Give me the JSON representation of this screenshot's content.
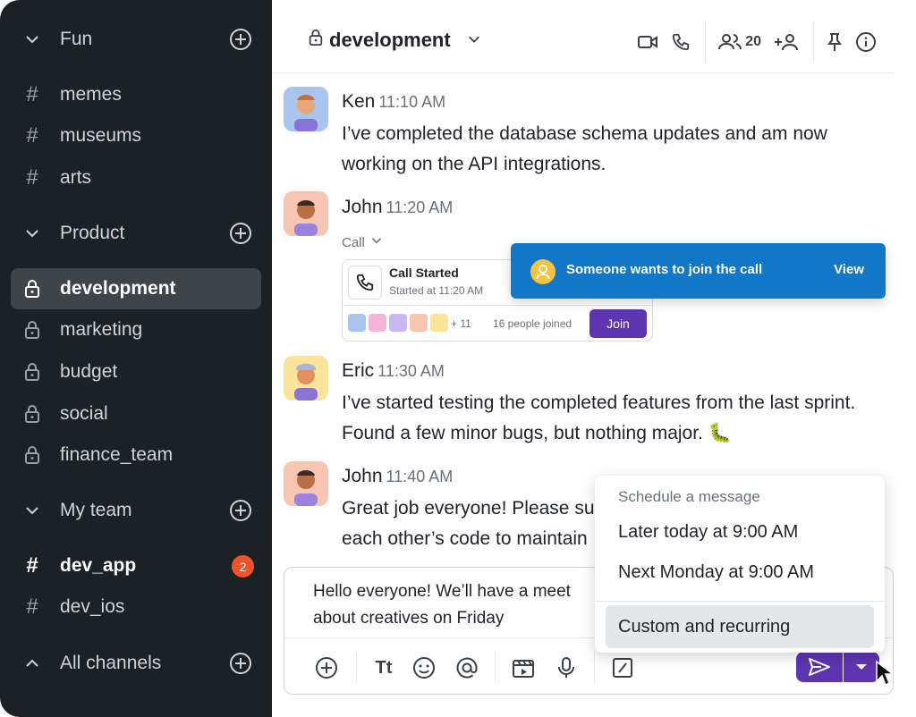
{
  "sidebar": {
    "sections": [
      {
        "label": "Fun"
      },
      {
        "label": "Product"
      },
      {
        "label": "My team"
      },
      {
        "label": "All channels"
      }
    ],
    "channels": {
      "memes": "memes",
      "museums": "museums",
      "arts": "arts",
      "development": "development",
      "marketing": "marketing",
      "budget": "budget",
      "social": "social",
      "finance_team": "finance_team",
      "dev_app": "dev_app",
      "dev_ios": "dev_ios"
    },
    "dev_app_badge": "2"
  },
  "header": {
    "title": "development",
    "member_count": "20"
  },
  "messages": [
    {
      "name": "Ken",
      "time": "11:10 AM",
      "text": "I’ve completed the database schema updates and am now working on the API integrations."
    },
    {
      "name": "John",
      "time": "11:20 AM"
    },
    {
      "name": "Eric",
      "time": "11:30 AM",
      "text": "I’ve started testing the completed features from the last sprint. Found a few minor bugs, but nothing major. 🐛"
    },
    {
      "name": "John",
      "time": "11:40 AM",
      "text_line1": "Great job everyone! Please su",
      "text_line2": "each other’s code to maintain"
    }
  ],
  "call": {
    "label": "Call",
    "title": "Call Started",
    "started_at": "Started at 11:20 AM",
    "more_count": "+ 11",
    "joined": "16 people joined",
    "join_label": "Join"
  },
  "toast": {
    "text": "Someone wants to join the call",
    "view_label": "View"
  },
  "composer": {
    "text": "Hello everyone! We’ll have a meet about creatives on Friday"
  },
  "schedule": {
    "heading": "Schedule a message",
    "options": [
      "Later today at 9:00 AM",
      "Next Monday at 9:00 AM"
    ],
    "custom": "Custom and recurring"
  },
  "colors": {
    "sidebar_bg": "#1c2126",
    "accent": "#5e35b1",
    "toast": "#1377c8",
    "badge": "#f0532c"
  }
}
